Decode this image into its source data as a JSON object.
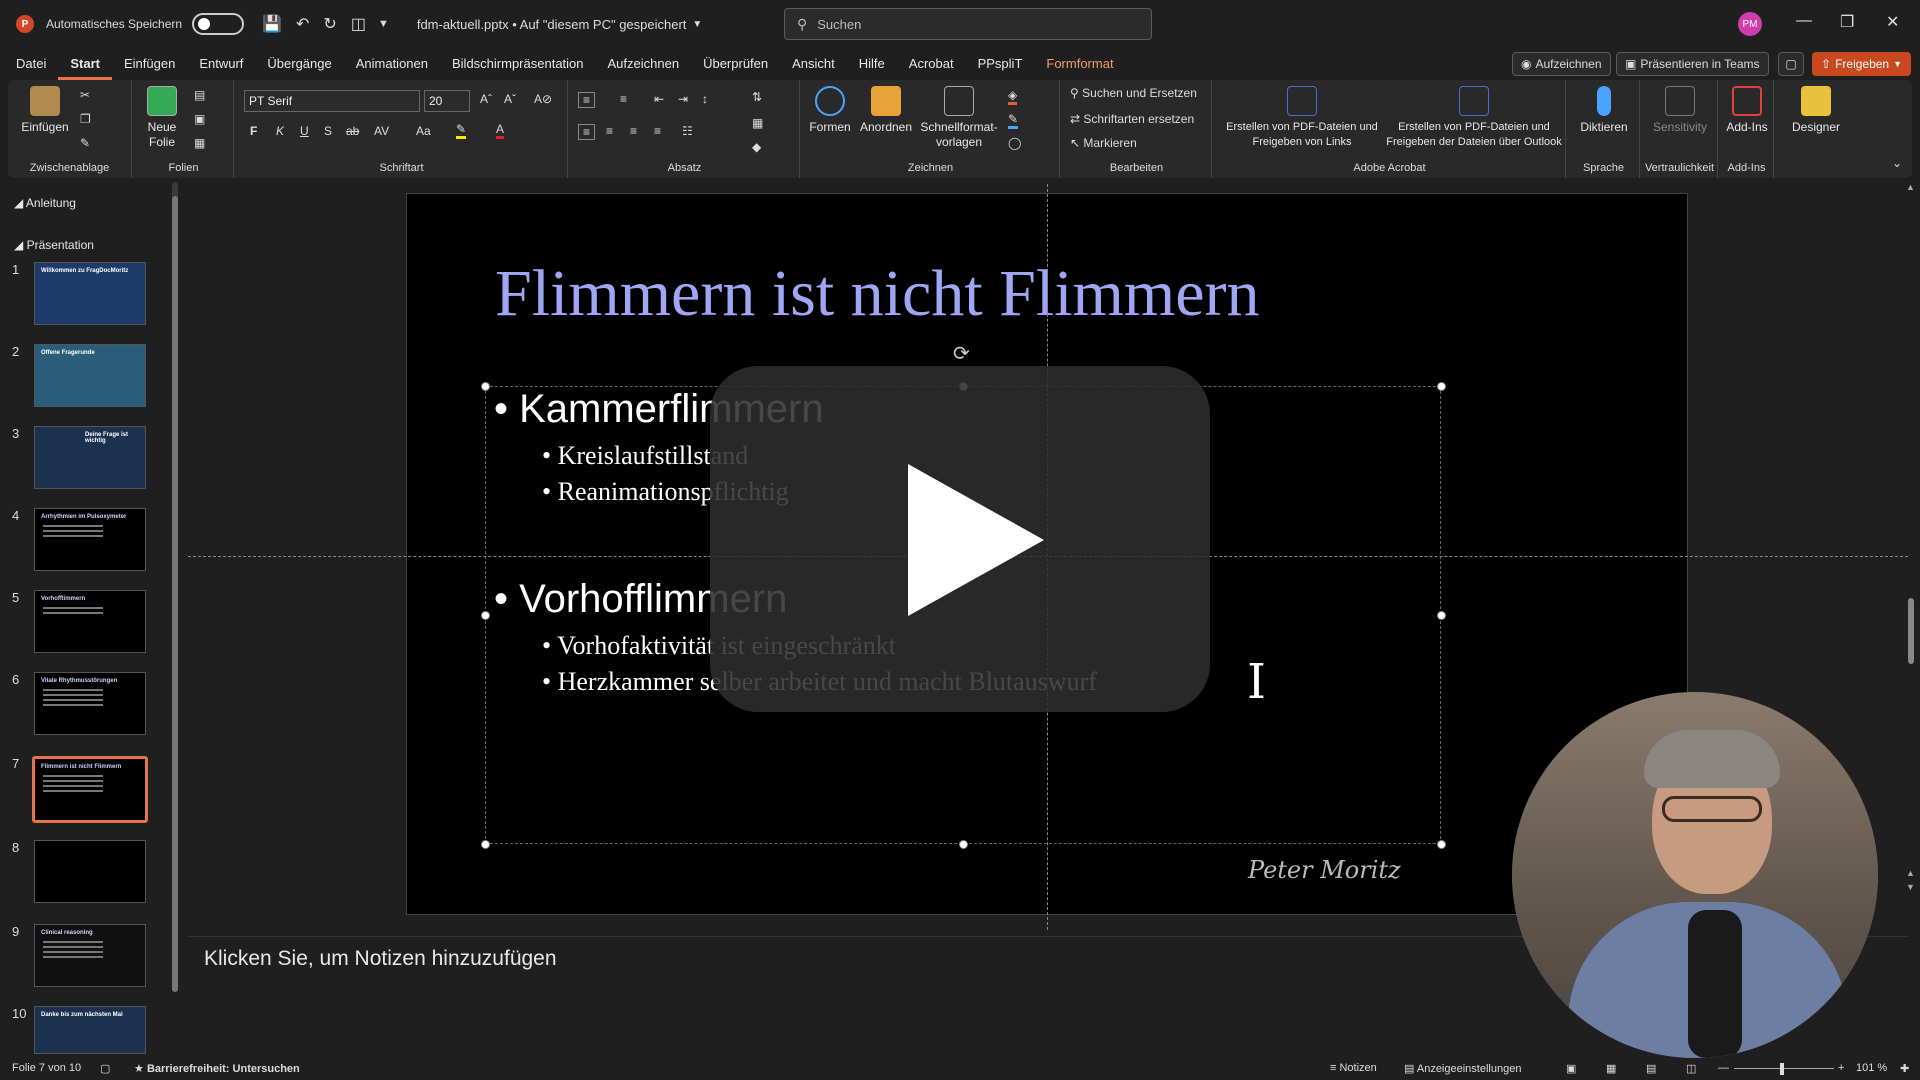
{
  "titlebar": {
    "logo": "P",
    "autosave_label": "Automatisches Speichern",
    "filename": "fdm-aktuell.pptx • Auf \"diesem PC\" gespeichert",
    "search_placeholder": "Suchen",
    "user_initials": "PM"
  },
  "menu": {
    "items": [
      "Datei",
      "Start",
      "Einfügen",
      "Entwurf",
      "Übergänge",
      "Animationen",
      "Bildschirmpräsentation",
      "Aufzeichnen",
      "Überprüfen",
      "Ansicht",
      "Hilfe",
      "Acrobat",
      "PPspliT",
      "Formformat"
    ],
    "active": "Start",
    "aufzeichnen_btn": "Aufzeichnen",
    "teams_btn": "Präsentieren in Teams",
    "share_btn": "Freigeben"
  },
  "ribbon": {
    "paste": "Einfügen",
    "clipboard_group": "Zwischenablage",
    "new_slide": "Neue Folie",
    "slides_group": "Folien",
    "font_name": "PT Serif",
    "font_size": "20",
    "font_group": "Schriftart",
    "bold": "F",
    "italic": "K",
    "underline": "U",
    "shadow": "S",
    "strike": "ab",
    "spacing": "AV",
    "case": "Aa",
    "paragraph_group": "Absatz",
    "shapes": "Formen",
    "arrange": "Anordnen",
    "quickstyles": "Schnellformat-vorlagen",
    "drawing_group": "Zeichnen",
    "find_replace": "Suchen und Ersetzen",
    "replace_fonts": "Schriftarten ersetzen",
    "select": "Markieren",
    "editing_group": "Bearbeiten",
    "pdf_links": "Erstellen von PDF-Dateien und Freigeben von Links",
    "pdf_outlook": "Erstellen von PDF-Dateien und Freigeben der Dateien über Outlook",
    "acrobat_group": "Adobe Acrobat",
    "dictate": "Diktieren",
    "voice_group": "Sprache",
    "sensitivity": "Sensitivity",
    "confidential_group": "Vertraulichkeit",
    "addins": "Add-Ins",
    "addins_group": "Add-Ins",
    "designer": "Designer"
  },
  "sidebar": {
    "section1": "Anleitung",
    "section2": "Präsentation",
    "thumbs": [
      {
        "num": "1",
        "title": "Willkommen zu FragDocMoritz"
      },
      {
        "num": "2",
        "title": "Offene Fragerunde"
      },
      {
        "num": "3",
        "title": "Deine Frage ist wichtig"
      },
      {
        "num": "4",
        "title": "Arrhythmien im Pulsoxymeter"
      },
      {
        "num": "5",
        "title": "Vorhofflimmern"
      },
      {
        "num": "6",
        "title": "Vitale Rhythmusstörungen"
      },
      {
        "num": "7",
        "title": "Flimmern ist nicht Flimmern"
      },
      {
        "num": "8",
        "title": ""
      },
      {
        "num": "9",
        "title": "Clinical reasoning"
      },
      {
        "num": "10",
        "title": "Danke bis zum nächsten Mal"
      }
    ]
  },
  "slide": {
    "title": "Flimmern ist nicht Flimmern",
    "bullet1": "• Kammerflimmern",
    "sub1a": "• Kreislaufstillstand",
    "sub1b": "• Reanimationspflichtig",
    "bullet2": "• Vorhofflimmern",
    "sub2a": "• Vorhofaktivität ist eingeschränkt",
    "sub2b": "• Herzkammer selber arbeitet und macht Blutauswurf",
    "signature": "Peter Moritz"
  },
  "notes": {
    "placeholder": "Klicken Sie, um Notizen hinzuzufügen"
  },
  "status": {
    "slide_info": "Folie 7 von 10",
    "accessibility": "Barrierefreiheit: Untersuchen",
    "notes_btn": "Notizen",
    "display_settings": "Anzeigeeinstellungen",
    "zoom": "101 %"
  }
}
